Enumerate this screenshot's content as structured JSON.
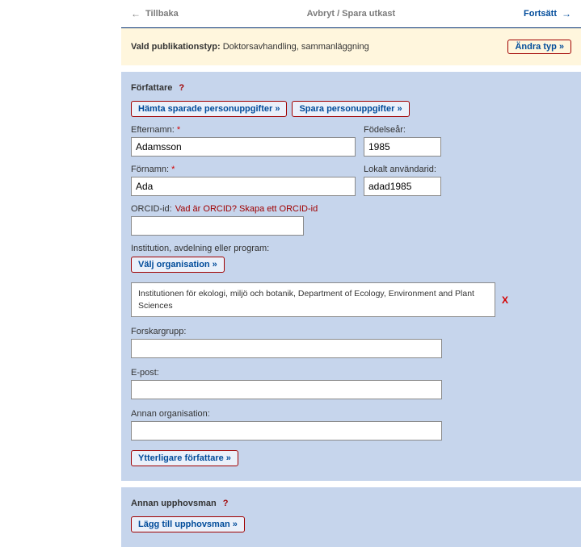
{
  "nav": {
    "back": "Tillbaka",
    "cancel_save": "Avbryt / Spara utkast",
    "continue": "Fortsätt"
  },
  "yellow": {
    "label_prefix": "Vald publikationstyp:",
    "value": "Doktorsavhandling, sammanläggning",
    "change_btn": "Ändra typ »"
  },
  "author": {
    "heading": "Författare",
    "help": "?",
    "fetch_btn": "Hämta sparade personuppgifter »",
    "save_btn": "Spara personuppgifter »",
    "lastname_label": "Efternamn:",
    "lastname_value": "Adamsson",
    "birthyear_label": "Födelseår:",
    "birthyear_value": "1985",
    "firstname_label": "Förnamn:",
    "firstname_value": "Ada",
    "localuser_label": "Lokalt användarid:",
    "localuser_value": "adad1985",
    "orcid_label": "ORCID-id:",
    "orcid_link": "Vad är ORCID? Skapa ett ORCID-id",
    "orcid_value": "",
    "inst_label": "Institution, avdelning eller program:",
    "select_org_btn": "Välj organisation »",
    "org_value": "Institutionen för ekologi, miljö och botanik, Department of Ecology, Environment and Plant Sciences",
    "remove_x": "X",
    "researchgroup_label": "Forskargrupp:",
    "researchgroup_value": "",
    "email_label": "E-post:",
    "email_value": "",
    "otherorg_label": "Annan organisation:",
    "otherorg_value": "",
    "more_authors_btn": "Ytterligare författare »"
  },
  "contributor": {
    "heading": "Annan upphovsman",
    "help": "?",
    "add_btn": "Lägg till upphovsman »"
  }
}
